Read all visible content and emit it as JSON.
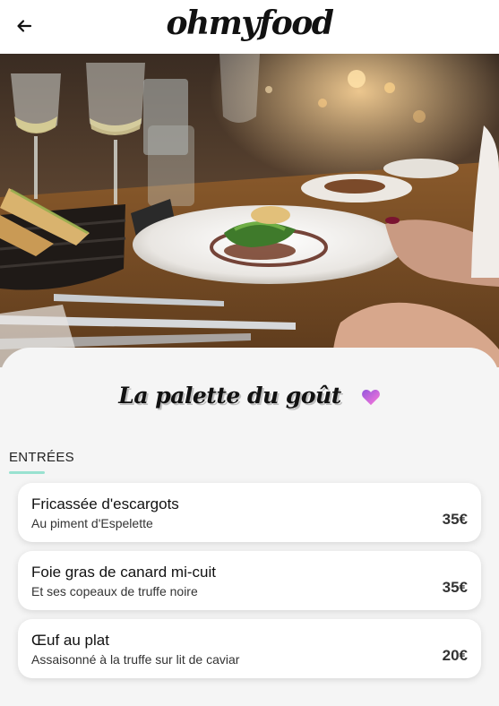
{
  "header": {
    "logo": "ohmyfood",
    "back_icon": "arrow-left-icon"
  },
  "hero": {
    "image_subject": "restaurant table with plated dish, wine glasses and bread basket"
  },
  "restaurant": {
    "name": "La palette du goût",
    "favorite_icon": "heart-icon",
    "favorite_color": "#b357d6"
  },
  "menu": {
    "section_title": "ENTRÉES",
    "accent_color": "#99e2d0",
    "items": [
      {
        "name": "Fricassée d'escargots",
        "description": "Au piment d'Espelette",
        "price": "35€"
      },
      {
        "name": "Foie gras de canard mi-cuit",
        "description": "Et ses copeaux de truffe noire",
        "price": "35€"
      },
      {
        "name": "Œuf au plat",
        "description": "Assaisonné à la truffe sur lit de caviar",
        "price": "20€"
      }
    ]
  }
}
